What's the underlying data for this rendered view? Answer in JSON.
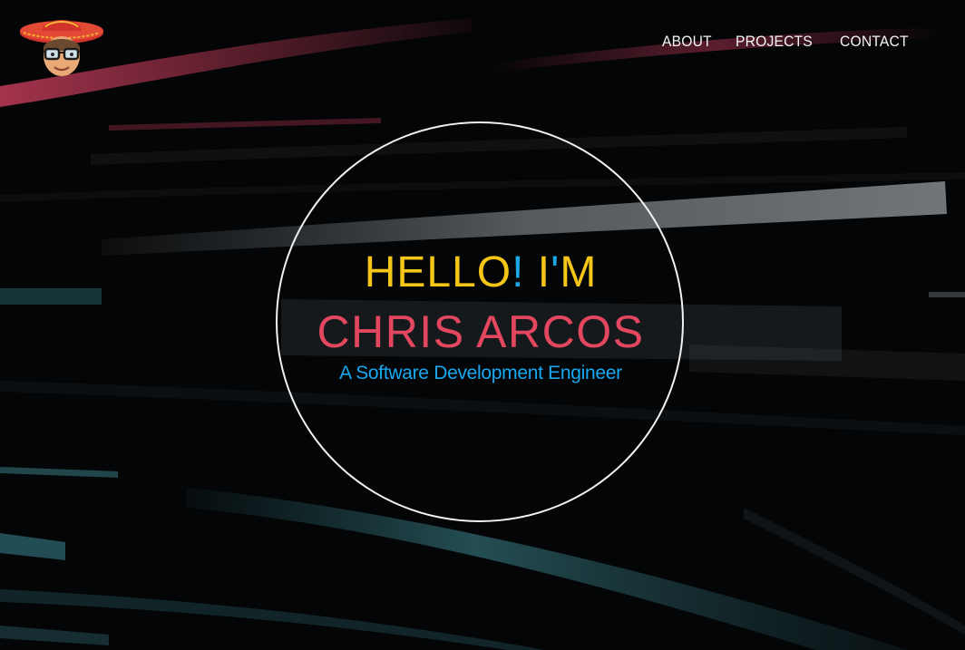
{
  "nav": {
    "items": [
      {
        "label": "ABOUT"
      },
      {
        "label": "PROJECTS"
      },
      {
        "label": "CONTACT"
      }
    ]
  },
  "hero": {
    "hello_word": "HELLO",
    "hello_bang": "!",
    "hello_i": "I",
    "hello_tick": "'",
    "hello_m": "M",
    "name": "CHRIS ARCOS",
    "tagline": "A Software Development Engineer"
  },
  "colors": {
    "hello": "#f5c518",
    "accent_blue": "#1ca7e6",
    "name": "#e2475f",
    "background": "#040506"
  },
  "icons": {
    "avatar": "sombrero-memoji-avatar"
  }
}
